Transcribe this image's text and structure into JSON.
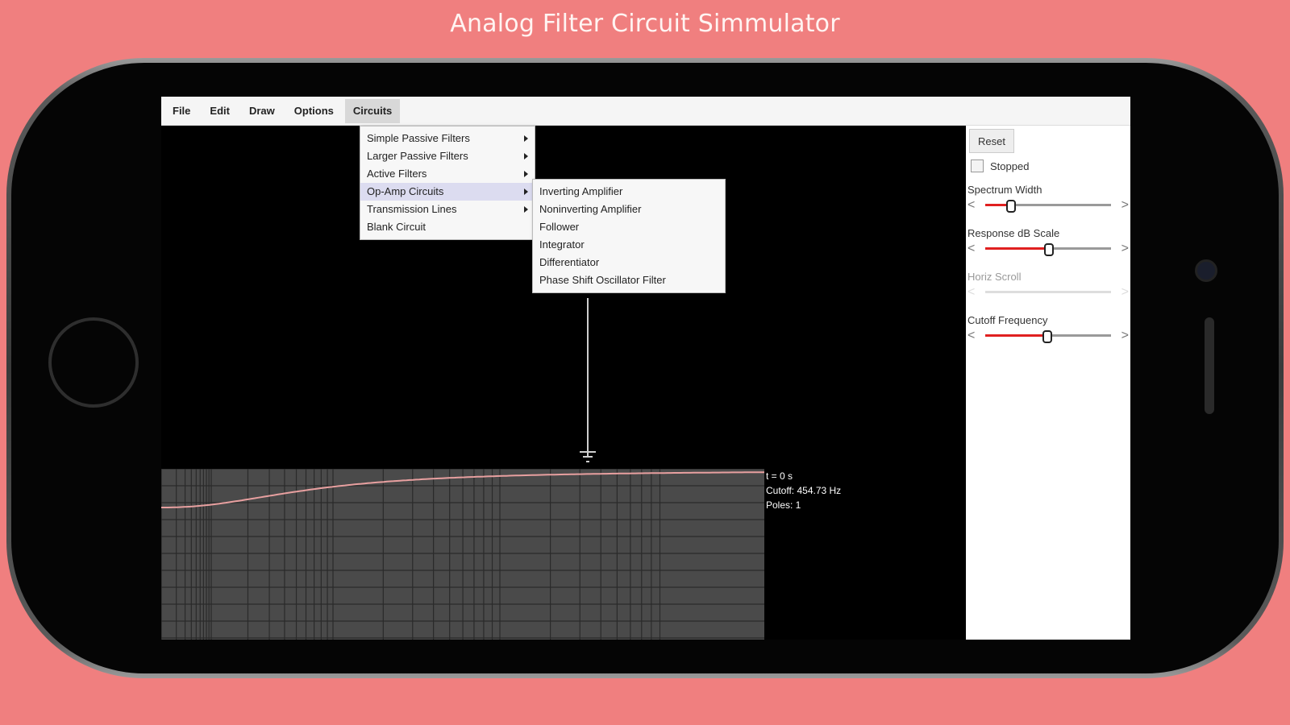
{
  "banner": "Analog Filter Circuit Simmulator",
  "menubar": {
    "items": [
      "File",
      "Edit",
      "Draw",
      "Options",
      "Circuits"
    ],
    "active": "Circuits"
  },
  "circuits_menu": {
    "items": [
      {
        "label": "Simple Passive Filters",
        "submenu": true
      },
      {
        "label": "Larger Passive Filters",
        "submenu": true
      },
      {
        "label": "Active Filters",
        "submenu": true
      },
      {
        "label": "Op-Amp Circuits",
        "submenu": true,
        "highlighted": true
      },
      {
        "label": "Transmission Lines",
        "submenu": true
      },
      {
        "label": "Blank Circuit",
        "submenu": false
      }
    ]
  },
  "opamp_submenu": {
    "items": [
      "Inverting Amplifier",
      "Noninverting Amplifier",
      "Follower",
      "Integrator",
      "Differentiator",
      "Phase Shift Oscillator Filter"
    ]
  },
  "graph_info": {
    "time": "t = 0 s",
    "cutoff": "Cutoff: 454.73 Hz",
    "poles": "Poles: 1"
  },
  "panel": {
    "reset_label": "Reset",
    "stopped_label": "Stopped",
    "stopped_checked": false,
    "sliders": [
      {
        "label": "Spectrum Width",
        "value": 0.2,
        "enabled": true
      },
      {
        "label": "Response dB Scale",
        "value": 0.5,
        "enabled": true
      },
      {
        "label": "Horiz Scroll",
        "value": 0.0,
        "enabled": false
      },
      {
        "label": "Cutoff Frequency",
        "value": 0.49,
        "enabled": true
      }
    ]
  },
  "colors": {
    "background": "#f07f7f",
    "graph_bg": "#4a4a4a",
    "graph_grid": "#2a2a2a",
    "response_curve": "#e8a0a0",
    "slider_fill": "#e02020"
  },
  "icons": [
    "submenu-arrow-icon",
    "ground-icon",
    "slider-left-arrow-icon",
    "slider-right-arrow-icon"
  ]
}
